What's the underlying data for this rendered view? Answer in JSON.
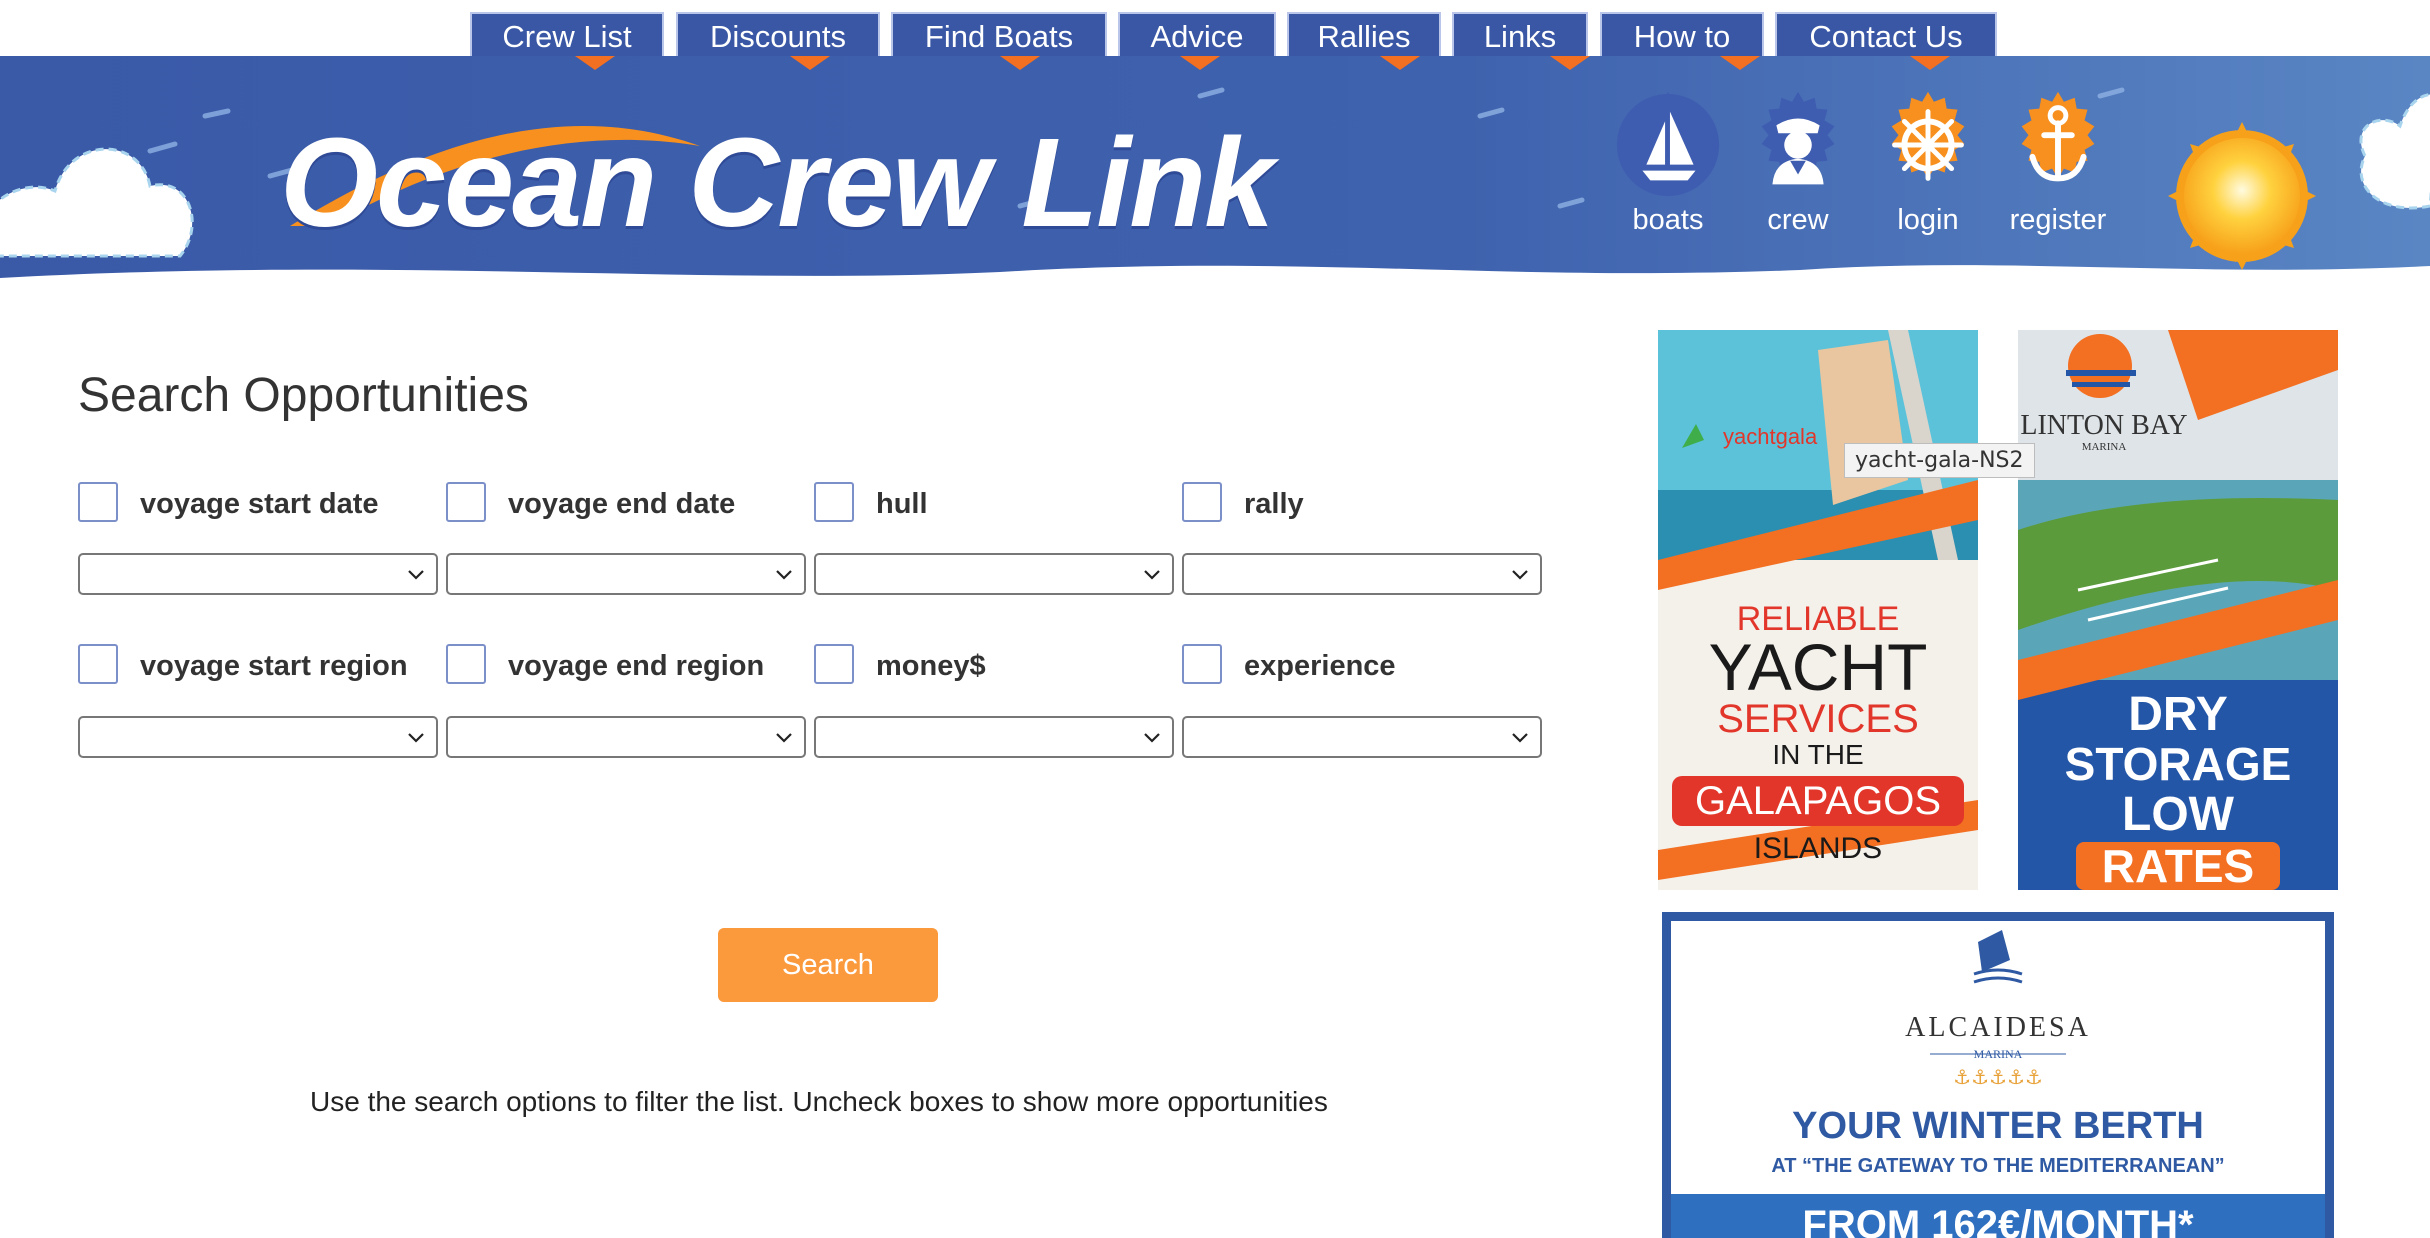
{
  "nav": {
    "items": [
      "Crew List",
      "Discounts",
      "Find Boats",
      "Advice",
      "Rallies",
      "Links",
      "How to",
      "Contact Us"
    ]
  },
  "header": {
    "logo_text": "Ocean Crew Link",
    "badges": [
      {
        "label": "boats",
        "icon": "sailboat-icon",
        "color": "#3f5db0"
      },
      {
        "label": "crew",
        "icon": "sailor-icon",
        "color": "#3f5db0"
      },
      {
        "label": "login",
        "icon": "ship-wheel-icon",
        "color": "#f7901e"
      },
      {
        "label": "register",
        "icon": "anchor-icon",
        "color": "#f7901e"
      }
    ]
  },
  "search": {
    "title": "Search Opportunities",
    "filters_row1": [
      "voyage start date",
      "voyage end date",
      "hull",
      "rally"
    ],
    "filters_row2": [
      "voyage start region",
      "voyage end region",
      "money$",
      "experience"
    ],
    "button_label": "Search",
    "help_text": "Use the search options to filter the list. Uncheck boxes to show more opportunities"
  },
  "ads": {
    "yachtgala": {
      "brand": "yachtgala",
      "lines": [
        "RELIABLE",
        "YACHT",
        "SERVICES",
        "IN THE",
        "GALAPAGOS",
        "ISLANDS"
      ],
      "tooltip": "yacht-gala-NS2"
    },
    "linton": {
      "brand": "LINTON BAY",
      "sub": "MARINA",
      "lines": [
        "DRY",
        "STORAGE",
        "LOW",
        "RATES"
      ]
    },
    "alcaidesa": {
      "brand": "ALCAIDESA",
      "sub": "MARINA",
      "stars": "⚓⚓⚓⚓⚓",
      "headline": "YOUR WINTER BERTH",
      "subline": "AT “THE GATEWAY TO THE MEDITERRANEAN”",
      "offer": "FROM 162€/MONTH*"
    }
  },
  "colors": {
    "nav_tab": "#3a57a5",
    "banner_blue": "#3e61ad",
    "accent_orange": "#fb993d",
    "checkbox_border": "#7b8fc8"
  }
}
